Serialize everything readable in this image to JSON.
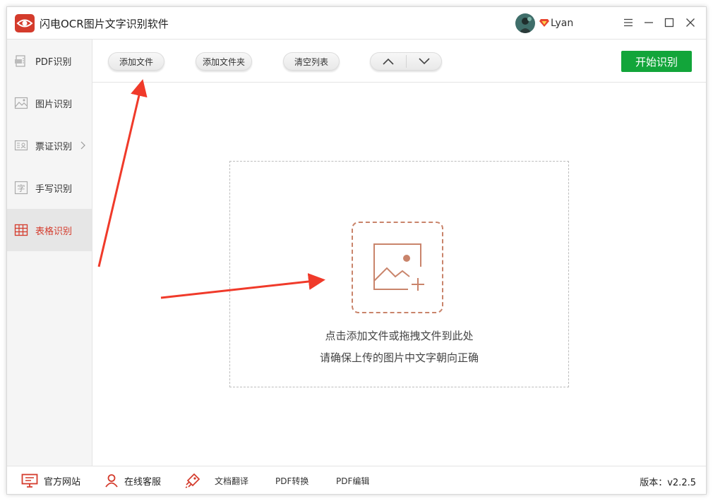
{
  "app": {
    "title": "闪电OCR图片文字识别软件",
    "username": "Lyan",
    "accent_color": "#d43b2c",
    "primary_button_color": "#12a53a"
  },
  "window_controls": [
    {
      "name": "menu-icon"
    },
    {
      "name": "minimize-icon"
    },
    {
      "name": "maximize-icon"
    },
    {
      "name": "close-icon"
    }
  ],
  "sidebar": {
    "items": [
      {
        "label": "PDF识别",
        "icon": "pdf-icon"
      },
      {
        "label": "图片识别",
        "icon": "image-icon"
      },
      {
        "label": "票证识别",
        "icon": "id-card-icon"
      },
      {
        "label": "手写识别",
        "icon": "handwriting-icon"
      },
      {
        "label": "表格识别",
        "icon": "table-icon",
        "active": true
      }
    ]
  },
  "toolbar": {
    "add_file": "添加文件",
    "add_folder": "添加文件夹",
    "clear_list": "清空列表",
    "start": "开始识别"
  },
  "dropzone": {
    "line1": "点击添加文件或拖拽文件到此处",
    "line2": "请确保上传的图片中文字朝向正确",
    "icon": "image-add-icon"
  },
  "footer": {
    "website": "官方网站",
    "support": "在线客服",
    "translate": "文档翻译",
    "pdf_convert": "PDF转换",
    "pdf_edit": "PDF编辑",
    "version": "版本：v2.2.5"
  }
}
